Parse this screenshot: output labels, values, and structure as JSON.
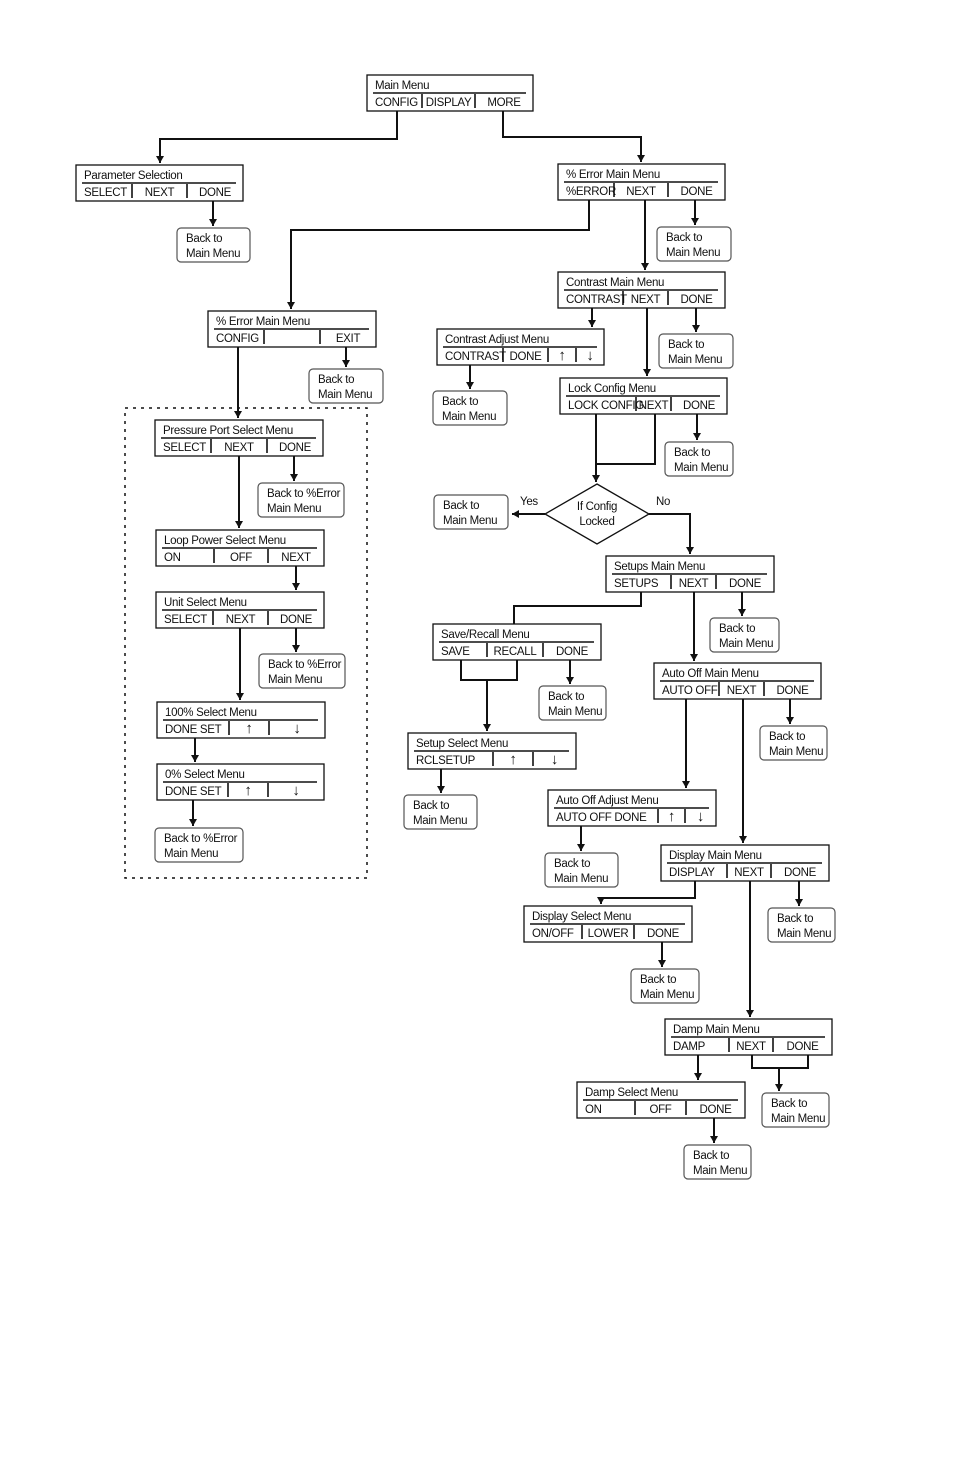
{
  "menus": [
    {
      "title": "Main Menu",
      "buttons": [
        "CONFIG",
        "DISPLAY",
        "MORE"
      ]
    },
    {
      "title": "Parameter Selection",
      "buttons": [
        "SELECT",
        "NEXT",
        "DONE"
      ]
    },
    {
      "title": "% Error Main Menu",
      "buttons": [
        "%ERROR",
        "NEXT",
        "DONE"
      ]
    },
    {
      "title": "% Error Main Menu",
      "buttons": [
        "CONFIG",
        "",
        "EXIT"
      ]
    },
    {
      "title": "Contrast  Main Menu",
      "buttons": [
        "CONTRAST",
        "NEXT",
        "DONE"
      ]
    },
    {
      "title": "Contrast Adjust Menu",
      "buttons": [
        "CONTRAST",
        "DONE",
        "↑",
        "↓"
      ]
    },
    {
      "title": "Lock Config  Menu",
      "buttons": [
        "LOCK CONFIG",
        "NEXT",
        "DONE"
      ]
    },
    {
      "title": "Pressure Port Select Menu",
      "buttons": [
        "SELECT",
        "NEXT",
        "DONE"
      ]
    },
    {
      "title": "Loop Power Select Menu",
      "buttons": [
        "ON",
        "OFF",
        "NEXT"
      ]
    },
    {
      "title": "Unit Select Menu",
      "buttons": [
        "SELECT",
        "NEXT",
        "DONE"
      ]
    },
    {
      "title": "100% Select Menu",
      "buttons": [
        "DONE SET",
        "↑",
        "↓"
      ]
    },
    {
      "title": "0% Select Menu",
      "buttons": [
        "DONE SET",
        "↑",
        "↓"
      ]
    },
    {
      "title": "Setups Main Menu",
      "buttons": [
        "SETUPS",
        "NEXT",
        "DONE"
      ]
    },
    {
      "title": "Save/Recall Menu",
      "buttons": [
        "SAVE",
        "RECALL",
        "DONE"
      ]
    },
    {
      "title": "Auto Off Main Menu",
      "buttons": [
        "AUTO OFF",
        "NEXT",
        "DONE"
      ]
    },
    {
      "title": "Setup Select Menu",
      "buttons": [
        "RCLSETUP",
        "↑",
        "↓"
      ]
    },
    {
      "title": "Auto Off Adjust Menu",
      "buttons": [
        "AUTO OFF   DONE",
        "↑",
        "↓"
      ]
    },
    {
      "title": "Display Main Menu",
      "buttons": [
        "DISPLAY",
        "NEXT",
        "DONE"
      ]
    },
    {
      "title": "Display Select Menu",
      "buttons": [
        "ON/OFF",
        "LOWER",
        "DONE"
      ]
    },
    {
      "title": "Damp Main Menu",
      "buttons": [
        "DAMP",
        "NEXT",
        "DONE"
      ]
    },
    {
      "title": "Damp Select Menu",
      "buttons": [
        "ON",
        "OFF",
        "DONE"
      ]
    }
  ],
  "back_boxes": [
    {
      "lines": [
        "Back to",
        "Main Menu"
      ]
    },
    {
      "lines": [
        "Back to",
        "Main Menu"
      ]
    },
    {
      "lines": [
        "Back to",
        "Main Menu"
      ]
    },
    {
      "lines": [
        "Back to",
        "Main Menu"
      ]
    },
    {
      "lines": [
        "Back to",
        "Main Menu"
      ]
    },
    {
      "lines": [
        "Back to",
        "Main Menu"
      ]
    },
    {
      "lines": [
        "Back to %Error",
        "Main Menu"
      ]
    },
    {
      "lines": [
        "Back to",
        "Main Menu"
      ]
    },
    {
      "lines": [
        "Back to",
        "Main Menu"
      ]
    },
    {
      "lines": [
        "Back to %Error",
        "Main Menu"
      ]
    },
    {
      "lines": [
        "Back to",
        "Main Menu"
      ]
    },
    {
      "lines": [
        "Back to",
        "Main Menu"
      ]
    },
    {
      "lines": [
        "Back to",
        "Main Menu"
      ]
    },
    {
      "lines": [
        "Back to",
        "Main Menu"
      ]
    },
    {
      "lines": [
        "Back to %Error",
        "Main Menu"
      ]
    },
    {
      "lines": [
        "Back to",
        "Main Menu"
      ]
    },
    {
      "lines": [
        "Back to",
        "Main Menu"
      ]
    },
    {
      "lines": [
        "Back to",
        "Main Menu"
      ]
    },
    {
      "lines": [
        "Back to",
        "Main Menu"
      ]
    }
  ],
  "decision": {
    "lines": [
      "If Config",
      "Locked"
    ],
    "yes_label": "Yes",
    "no_label": "No"
  },
  "colors": {
    "line": "#111111",
    "background": "#ffffff"
  }
}
